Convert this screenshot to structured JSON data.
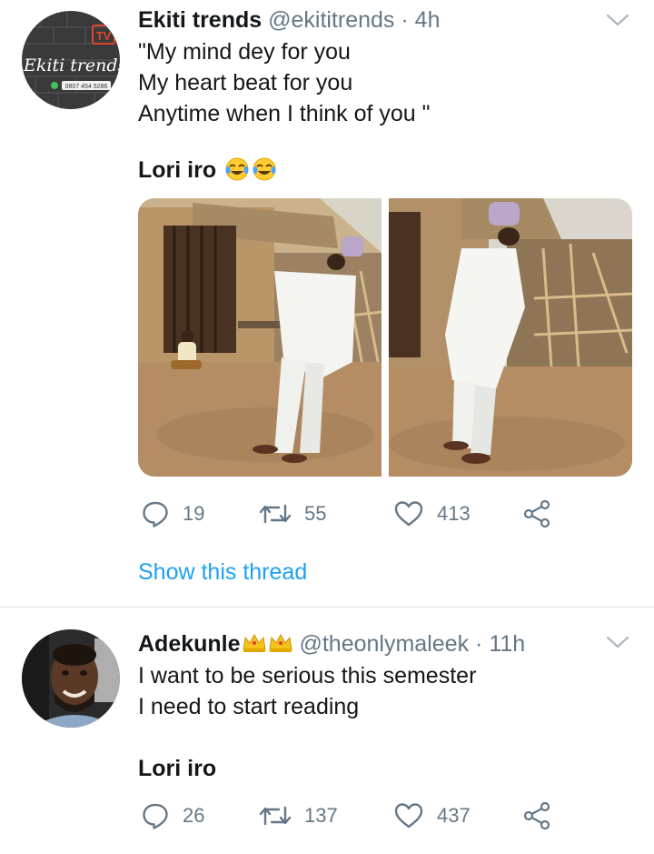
{
  "tweets": [
    {
      "author_name": "Ekiti trends",
      "handle": "@ekititrends",
      "separator": "·",
      "time": "4h",
      "avatar_text": {
        "logo_script": "Ekiti trends",
        "logo_tv": "TV",
        "phone": "0807 454 5286"
      },
      "lines": [
        "\"My mind dey for you",
        "My heart beat for you",
        "Anytime when I think of you \""
      ],
      "tagline": "Lori iro",
      "emoji": [
        "face-with-tears-of-joy",
        "face-with-tears-of-joy"
      ],
      "media_count": 2,
      "stats": {
        "replies": "19",
        "retweets": "55",
        "likes": "413"
      },
      "thread_link": "Show this thread"
    },
    {
      "author_name": "Adekunle",
      "author_badges": [
        "crown-emoji",
        "crown-emoji"
      ],
      "handle": "@theonlymaleek",
      "separator": "·",
      "time": "11h",
      "lines": [
        "I want to be serious this semester",
        "I need to start reading"
      ],
      "tagline": "Lori iro",
      "stats": {
        "replies": "26",
        "retweets": "137",
        "likes": "437"
      }
    }
  ],
  "colors": {
    "text": "#14171a",
    "secondary": "#657786",
    "link": "#1da1f2",
    "divider": "#e1e8ed"
  }
}
